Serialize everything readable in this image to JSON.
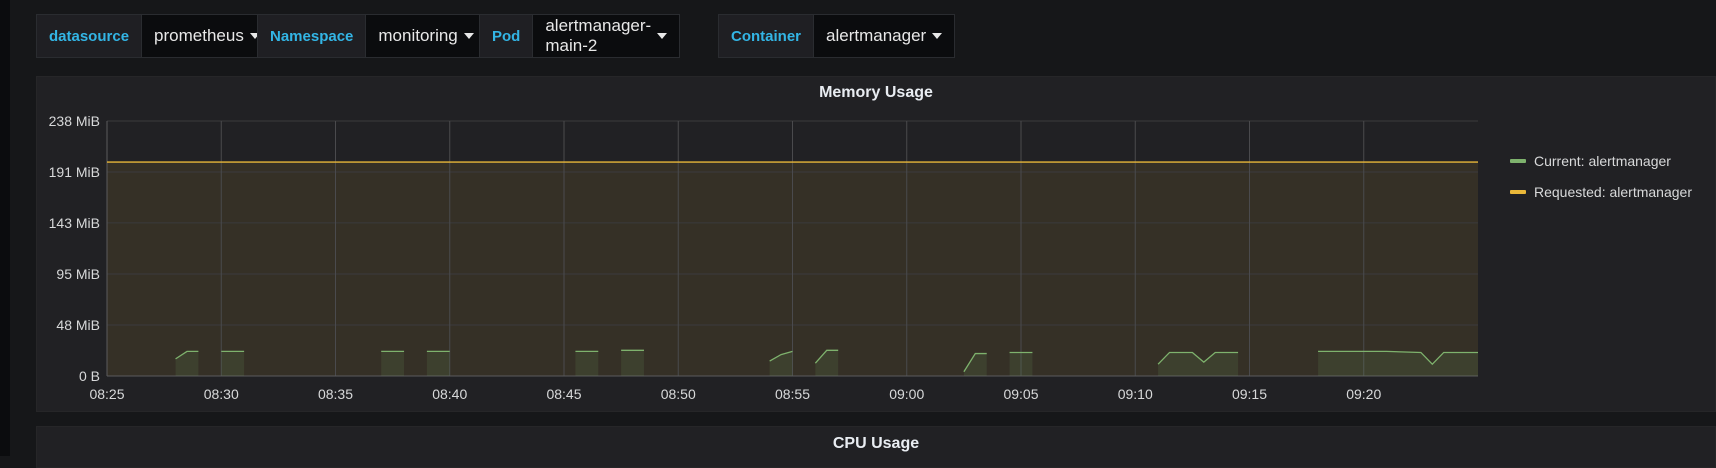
{
  "variables": [
    {
      "label": "datasource",
      "value": "prometheus"
    },
    {
      "label": "Namespace",
      "value": "monitoring"
    },
    {
      "label": "Pod",
      "value": "alertmanager-main-2"
    },
    {
      "label": "Container",
      "value": "alertmanager"
    }
  ],
  "memory_panel": {
    "title": "Memory Usage",
    "legend": [
      {
        "label": "Current: alertmanager",
        "color": "#7eb26d"
      },
      {
        "label": "Requested: alertmanager",
        "color": "#eab839"
      }
    ]
  },
  "cpu_panel": {
    "title": "CPU Usage"
  },
  "chart_data": {
    "type": "line",
    "title": "Memory Usage",
    "y_unit": "MiB",
    "y_ticks": [
      "0 B",
      "48 MiB",
      "95 MiB",
      "143 MiB",
      "191 MiB",
      "238 MiB"
    ],
    "y_tick_values": [
      0,
      47.7,
      95.4,
      143.1,
      190.7,
      238.4
    ],
    "ylim": [
      0,
      238.4
    ],
    "x_ticks": [
      "08:25",
      "08:30",
      "08:35",
      "08:40",
      "08:45",
      "08:50",
      "08:55",
      "09:00",
      "09:05",
      "09:10",
      "09:15",
      "09:20"
    ],
    "x_range": [
      "08:25",
      "09:25"
    ],
    "grid": true,
    "legend_position": "right",
    "series": [
      {
        "name": "Requested: alertmanager",
        "color": "#eab839",
        "segments": [
          [
            [
              "08:25",
              200
            ],
            [
              "09:25",
              200
            ]
          ]
        ]
      },
      {
        "name": "Current: alertmanager",
        "color": "#7eb26d",
        "segments": [
          [
            [
              "08:28",
              16
            ],
            [
              "08:28.5",
              23
            ],
            [
              "08:29",
              23
            ]
          ],
          [
            [
              "08:30",
              23
            ],
            [
              "08:31",
              23
            ]
          ],
          [
            [
              "08:37",
              23
            ],
            [
              "08:38",
              23
            ]
          ],
          [
            [
              "08:39",
              23
            ],
            [
              "08:40",
              23
            ]
          ],
          [
            [
              "08:45.5",
              23
            ],
            [
              "08:46.5",
              23
            ]
          ],
          [
            [
              "08:47.5",
              24
            ],
            [
              "08:48.5",
              24
            ]
          ],
          [
            [
              "08:54",
              14
            ],
            [
              "08:54.5",
              20
            ],
            [
              "08:55",
              23
            ]
          ],
          [
            [
              "08:56",
              12
            ],
            [
              "08:56.5",
              24
            ],
            [
              "08:57",
              24
            ]
          ],
          [
            [
              "09:02.5",
              4
            ],
            [
              "09:03",
              21
            ],
            [
              "09:03.5",
              21
            ]
          ],
          [
            [
              "09:04.5",
              22
            ],
            [
              "09:05.5",
              22
            ]
          ],
          [
            [
              "09:11",
              11
            ],
            [
              "09:11.5",
              22
            ],
            [
              "09:12.5",
              22
            ],
            [
              "09:13",
              13
            ],
            [
              "09:13.5",
              22
            ],
            [
              "09:14.5",
              22
            ]
          ],
          [
            [
              "09:18",
              23
            ],
            [
              "09:21",
              23
            ],
            [
              "09:22.5",
              22
            ],
            [
              "09:23",
              11
            ],
            [
              "09:23.5",
              22
            ],
            [
              "09:25",
              22
            ]
          ]
        ]
      }
    ]
  }
}
